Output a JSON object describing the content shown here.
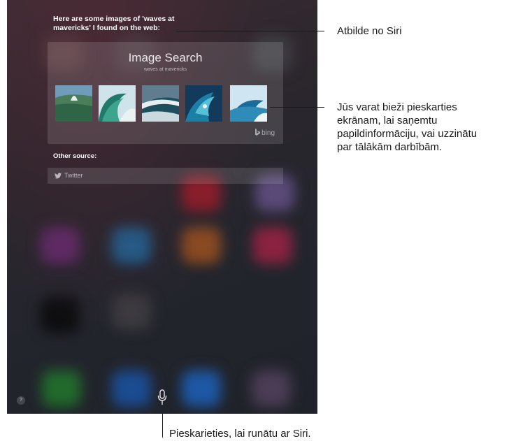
{
  "siri": {
    "response": "Here are some images of 'waves at mavericks' I found on the web:"
  },
  "card": {
    "title": "Image Search",
    "subtitle": "waves at mavericks",
    "provider": "bing"
  },
  "other_source": {
    "heading": "Other source:",
    "items": [
      {
        "label": "Twitter",
        "icon": "twitter-bird-icon"
      }
    ]
  },
  "controls": {
    "help": "?",
    "mic_icon": "microphone-icon"
  },
  "callouts": {
    "response": "Atbilde no Siri",
    "tap_screen_line1": "Jūs varat bieži pieskarties",
    "tap_screen_line2": "ekrānam, lai saņemtu",
    "tap_screen_line3": "papildinformāciju, vai uzzinātu",
    "tap_screen_line4": "par tālākām darbībām.",
    "tap_mic": "Pieskarieties, lai runātu ar Siri."
  },
  "colors": {
    "screen_bg": "#23252d",
    "text_primary": "#ffffff",
    "callout_text": "#1a1a1a"
  }
}
